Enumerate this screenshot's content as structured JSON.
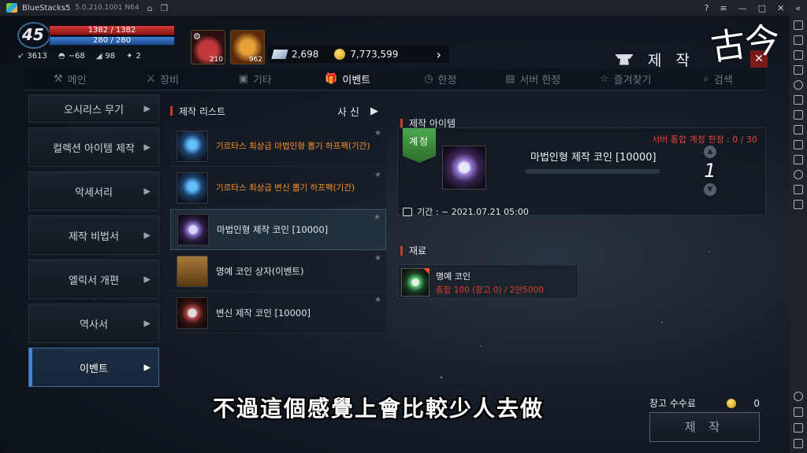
{
  "emulator": {
    "title": "BlueStacks5",
    "version": "5.0.210.1001 N64",
    "controls": [
      "?",
      "≡",
      "—",
      "□",
      "✕",
      "«"
    ]
  },
  "hud": {
    "level": "45",
    "hp": "1382 / 1382",
    "mp": "280 / 280",
    "stats": [
      {
        "icon": "wing-icon",
        "value": "3613"
      },
      {
        "icon": "helmet-icon",
        "value": "−68"
      },
      {
        "icon": "boot-icon",
        "value": "98"
      },
      {
        "icon": "claw-icon",
        "value": "2"
      }
    ],
    "slot1_count": "210",
    "slot2_count": "962",
    "gems": "2,698",
    "gold": "7,773,599",
    "screen_title": "제 작",
    "watermark": "古今"
  },
  "tabs": [
    {
      "label": "메인",
      "icon": "anvil-icon",
      "glyph": "⚒"
    },
    {
      "label": "장비",
      "icon": "crossed-swords-icon",
      "glyph": "⚔"
    },
    {
      "label": "기타",
      "icon": "box-icon",
      "glyph": "▣"
    },
    {
      "label": "이벤트",
      "icon": "gift-icon",
      "glyph": "🎁"
    },
    {
      "label": "한정",
      "icon": "stopwatch-icon",
      "glyph": "◷"
    },
    {
      "label": "서버 한정",
      "icon": "server-icon",
      "glyph": "▤"
    },
    {
      "label": "즐겨찾기",
      "icon": "star-icon",
      "glyph": "☆"
    },
    {
      "label": "검색",
      "icon": "search-icon",
      "glyph": "⌕"
    }
  ],
  "categories": [
    {
      "label": "오시리스 무기"
    },
    {
      "label": "컬렉션 아이템 제작"
    },
    {
      "label": "악세서리"
    },
    {
      "label": "제작 비법서"
    },
    {
      "label": "엘릭서 개편"
    },
    {
      "label": "역사서"
    },
    {
      "label": "이벤트"
    }
  ],
  "craft_list": {
    "header": "제작 리스트",
    "photo_button": "사 신",
    "items": [
      {
        "name": "기르타스 최상급 마법인형 뽑기 하프팩(기간)",
        "style": "orange",
        "thumb": "th-card"
      },
      {
        "name": "기르타스 최상급 변신 뽑기 하프팩(기간)",
        "style": "orange",
        "thumb": "th-card"
      },
      {
        "name": "마법인형 제작 코인 [10000]",
        "style": "normal",
        "thumb": "th-coinp"
      },
      {
        "name": "명예 코인 상자(이벤트)",
        "style": "normal",
        "thumb": "th-chest"
      },
      {
        "name": "변신 제작 코인 [10000]",
        "style": "normal",
        "thumb": "th-coinr"
      }
    ]
  },
  "craft_item": {
    "header": "제작 아이템",
    "limit": "서버 통합 계정 한정 : 0 / 30",
    "badge": "계정",
    "name": "마법인형 제작 코인 [10000]",
    "quantity": "1",
    "period": "기간 : ~ 2021.07.21 05:00"
  },
  "materials": {
    "header": "재료",
    "items": [
      {
        "name": "명예 코인",
        "qty": "총합 100 (창고 0) / 2만5000"
      }
    ]
  },
  "footer": {
    "subtitle": "不過這個感覺上會比較少人去做",
    "fee_label": "창고 수수료",
    "fee_value": "0",
    "craft_button": "제 작"
  },
  "colors": {
    "accent_red": "#e2453a",
    "orange_text": "#ff8f2a",
    "active_blue": "#3f86d6",
    "badge_green": "#4ba84a"
  }
}
